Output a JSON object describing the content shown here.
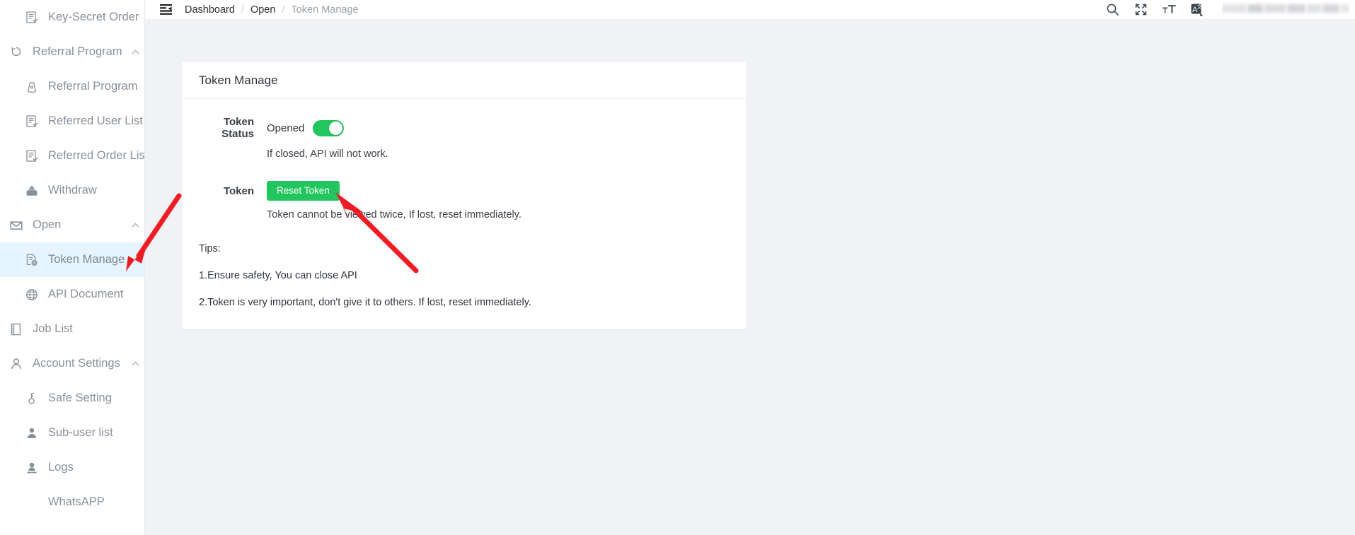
{
  "sidebar": {
    "items": [
      {
        "label": "Key-Secret Order",
        "icon": "order-doc-icon",
        "level": "child",
        "active": false,
        "expandable": false
      },
      {
        "label": "Referral Program",
        "icon": "referral-icon",
        "level": "group",
        "active": false,
        "expandable": true,
        "expanded": true
      },
      {
        "label": "Referral Program",
        "icon": "bag-icon",
        "level": "child",
        "active": false,
        "expandable": false
      },
      {
        "label": "Referred User List",
        "icon": "order-doc-icon",
        "level": "child",
        "active": false,
        "expandable": false
      },
      {
        "label": "Referred Order List",
        "icon": "order-doc-icon",
        "level": "child",
        "active": false,
        "expandable": false
      },
      {
        "label": "Withdraw",
        "icon": "withdraw-icon",
        "level": "child",
        "active": false,
        "expandable": false
      },
      {
        "label": "Open",
        "icon": "envelope-icon",
        "level": "group",
        "active": false,
        "expandable": true,
        "expanded": true
      },
      {
        "label": "Token Manage",
        "icon": "token-doc-icon",
        "level": "child",
        "active": true,
        "expandable": false
      },
      {
        "label": "API Document",
        "icon": "globe-icon",
        "level": "child",
        "active": false,
        "expandable": false
      },
      {
        "label": "Job List",
        "icon": "job-list-icon",
        "level": "plain",
        "active": false,
        "expandable": false
      },
      {
        "label": "Account Settings",
        "icon": "user-outline-icon",
        "level": "group",
        "active": false,
        "expandable": true,
        "expanded": true
      },
      {
        "label": "Safe Setting",
        "icon": "key-icon",
        "level": "child",
        "active": false,
        "expandable": false
      },
      {
        "label": "Sub-user list",
        "icon": "user-solid-icon",
        "level": "child",
        "active": false,
        "expandable": false
      },
      {
        "label": "Logs",
        "icon": "user-log-icon",
        "level": "child",
        "active": false,
        "expandable": false
      },
      {
        "label": "WhatsAPP",
        "icon": "",
        "level": "noicon",
        "active": false,
        "expandable": false
      }
    ]
  },
  "topbar": {
    "fold_icon": "menu-fold-icon",
    "breadcrumb": [
      {
        "label": "Dashboard",
        "current": false
      },
      {
        "label": "Open",
        "current": false
      },
      {
        "label": "Token Manage",
        "current": true
      }
    ],
    "separator": "/",
    "actions": [
      {
        "name": "search-icon"
      },
      {
        "name": "fullscreen-icon"
      },
      {
        "name": "font-size-icon"
      },
      {
        "name": "translate-icon"
      }
    ]
  },
  "card": {
    "title": "Token Manage",
    "token_status": {
      "label": "Token Status",
      "value": "Opened",
      "switch_on": true,
      "hint": "If closed, API will not work."
    },
    "token": {
      "label": "Token",
      "button_label": "Reset Token",
      "hint": "Token cannot be viewed twice, If lost, reset immediately."
    },
    "tips": {
      "heading": "Tips:",
      "lines": [
        "1.Ensure safety, You can close API",
        "2.Token is very important, don't give it to others. If lost, reset immediately."
      ]
    }
  },
  "colors": {
    "accent_green": "#22c55e",
    "active_nav_bg": "#e6f4ff",
    "annotation_red": "#ee1c25",
    "page_bg": "#f0f2f5"
  },
  "annotations": {
    "arrow_to_sidebar": "red-arrow-pointing-to-token-manage-nav",
    "arrow_to_button": "red-arrow-pointing-to-reset-token-button"
  }
}
